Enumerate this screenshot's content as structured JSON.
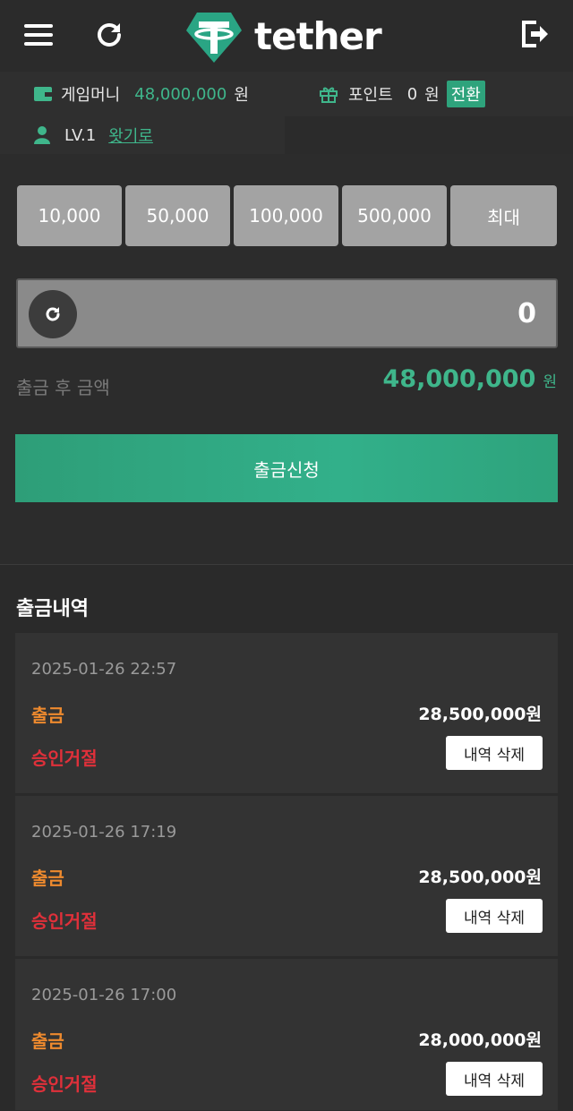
{
  "header": {
    "logo_text": "tether",
    "icons": {
      "menu": "menu-icon",
      "refresh": "refresh-icon",
      "logout": "logout-icon",
      "logo": "tether-logo-icon"
    }
  },
  "wallet": {
    "game_money_label": "게임머니",
    "game_money_value": "48,000,000",
    "game_money_unit": "원",
    "point_label": "포인트",
    "point_value": "0",
    "point_unit": "원",
    "convert_label": "전환",
    "level": "LV.1",
    "level_link": "왓기로"
  },
  "amount_buttons": [
    "10,000",
    "50,000",
    "100,000",
    "500,000",
    "최대"
  ],
  "amount_input": {
    "value": "0"
  },
  "after_balance": {
    "label": "출금 후 금액",
    "value": "48,000,000",
    "unit": "원"
  },
  "withdraw_button": "출금신청",
  "history": {
    "title": "출금내역",
    "records": [
      {
        "date": "2025-01-26 22:57",
        "type": "출금",
        "amount": "28,500,000원",
        "status": "승인거절",
        "delete_label": "내역 삭제"
      },
      {
        "date": "2025-01-26 17:19",
        "type": "출금",
        "amount": "28,500,000원",
        "status": "승인거절",
        "delete_label": "내역 삭제"
      },
      {
        "date": "2025-01-26 17:00",
        "type": "출금",
        "amount": "28,000,000원",
        "status": "승인거절",
        "delete_label": "내역 삭제"
      }
    ]
  },
  "colors": {
    "accent": "#3fb68b",
    "button_green": "#2ea37c",
    "type_orange": "#ee8a2e",
    "status_red": "#e0303a",
    "background": "#2a2a2a"
  }
}
